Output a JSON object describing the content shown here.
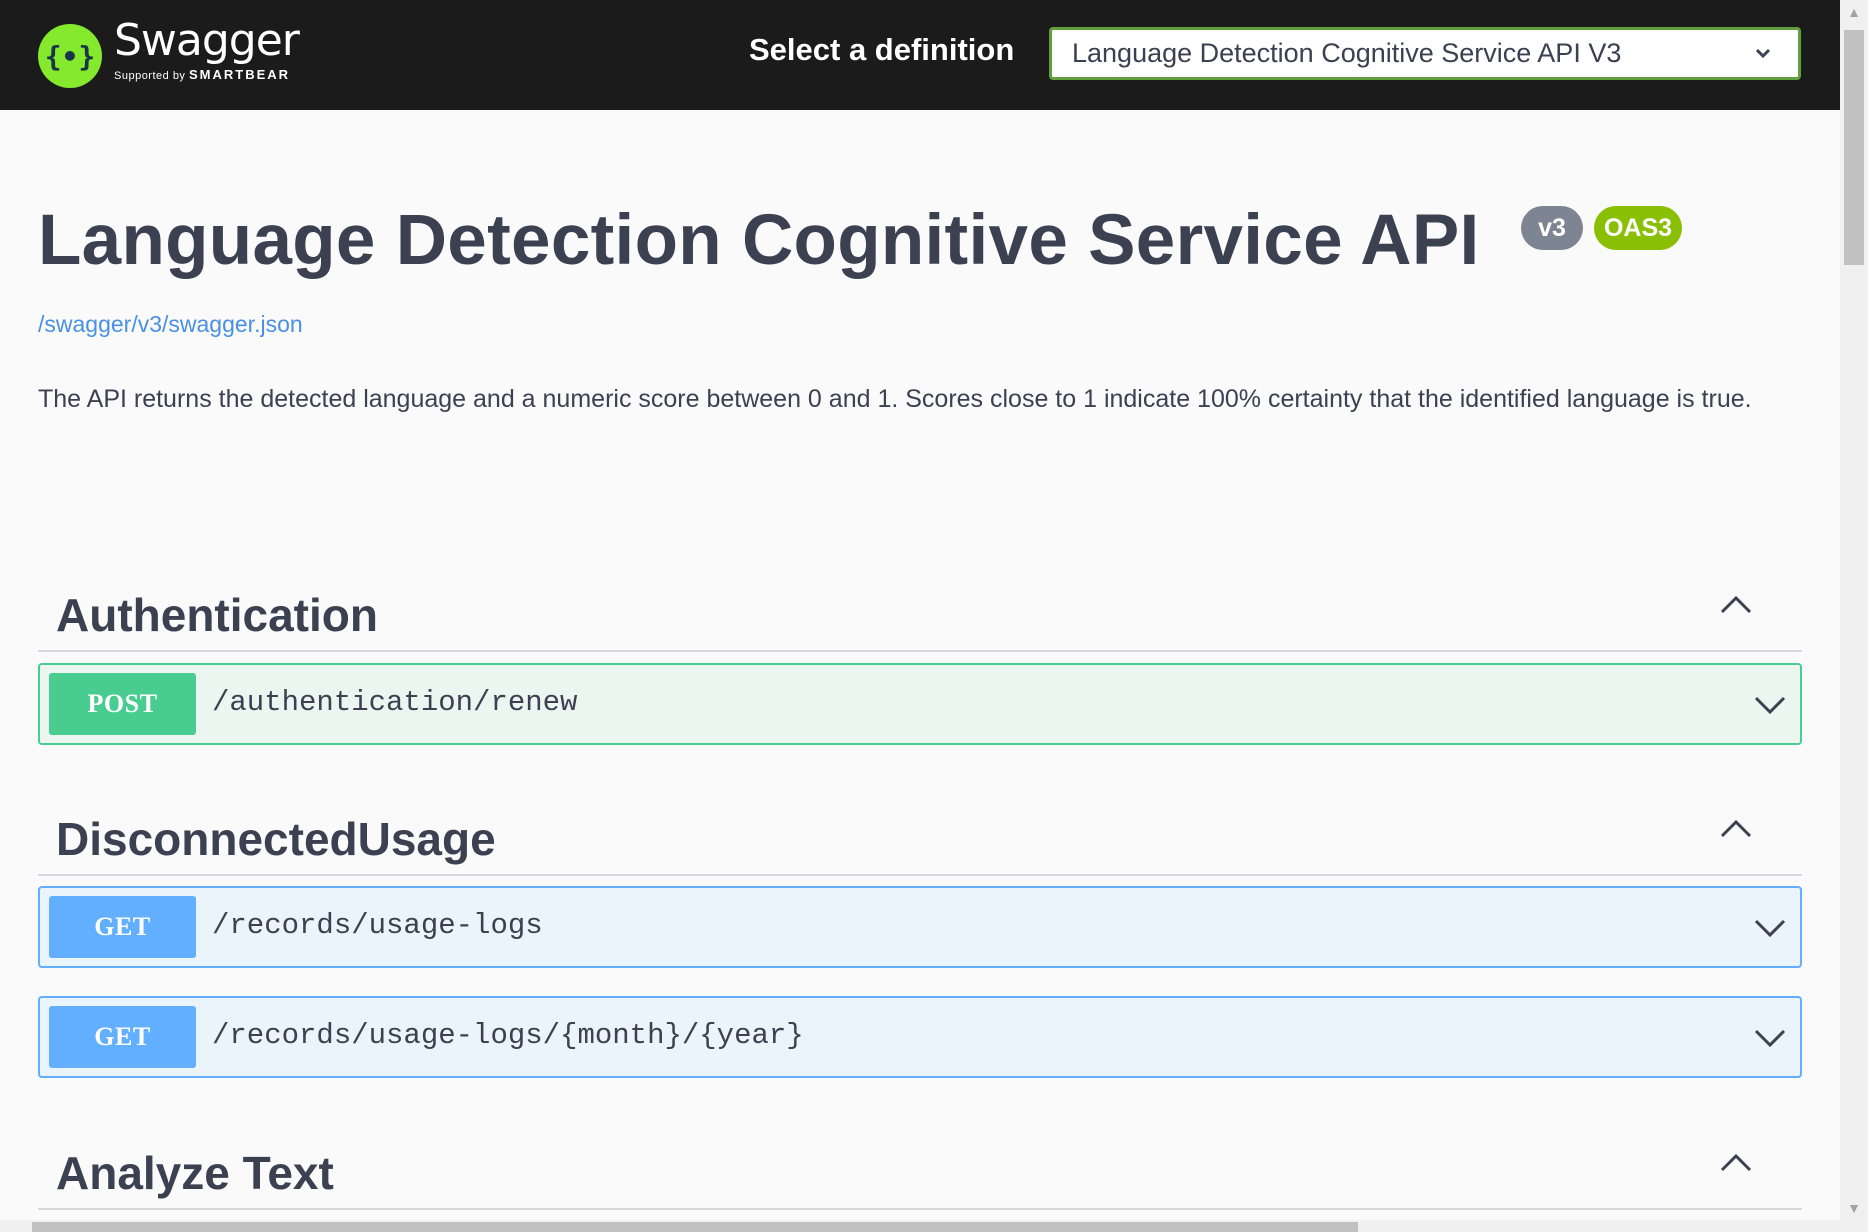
{
  "topbar": {
    "logo_word": "Swagger",
    "logo_sub_prefix": "Supported by",
    "logo_sub_brand": "SMARTBEAR",
    "select_label": "Select a definition",
    "selected_definition": "Language Detection Cognitive Service API V3"
  },
  "info": {
    "title": "Language Detection Cognitive Service API",
    "version_badge": "v3",
    "oas_badge": "OAS3",
    "spec_link": "/swagger/v3/swagger.json",
    "description": "The API returns the detected language and a numeric score between 0 and 1. Scores close to 1 indicate 100% certainty that the identified language is true."
  },
  "sections": [
    {
      "title": "Authentication",
      "operations": [
        {
          "method": "POST",
          "path": "/authentication/renew"
        }
      ]
    },
    {
      "title": "DisconnectedUsage",
      "operations": [
        {
          "method": "GET",
          "path": "/records/usage-logs"
        },
        {
          "method": "GET",
          "path": "/records/usage-logs/{month}/{year}"
        }
      ]
    },
    {
      "title": "Analyze Text",
      "operations": []
    }
  ],
  "colors": {
    "topbar_bg": "#1b1b1b",
    "post": "#49cc90",
    "get": "#61affe",
    "oas_badge": "#89bf04",
    "version_badge": "#7d8492",
    "link": "#4990e2"
  }
}
